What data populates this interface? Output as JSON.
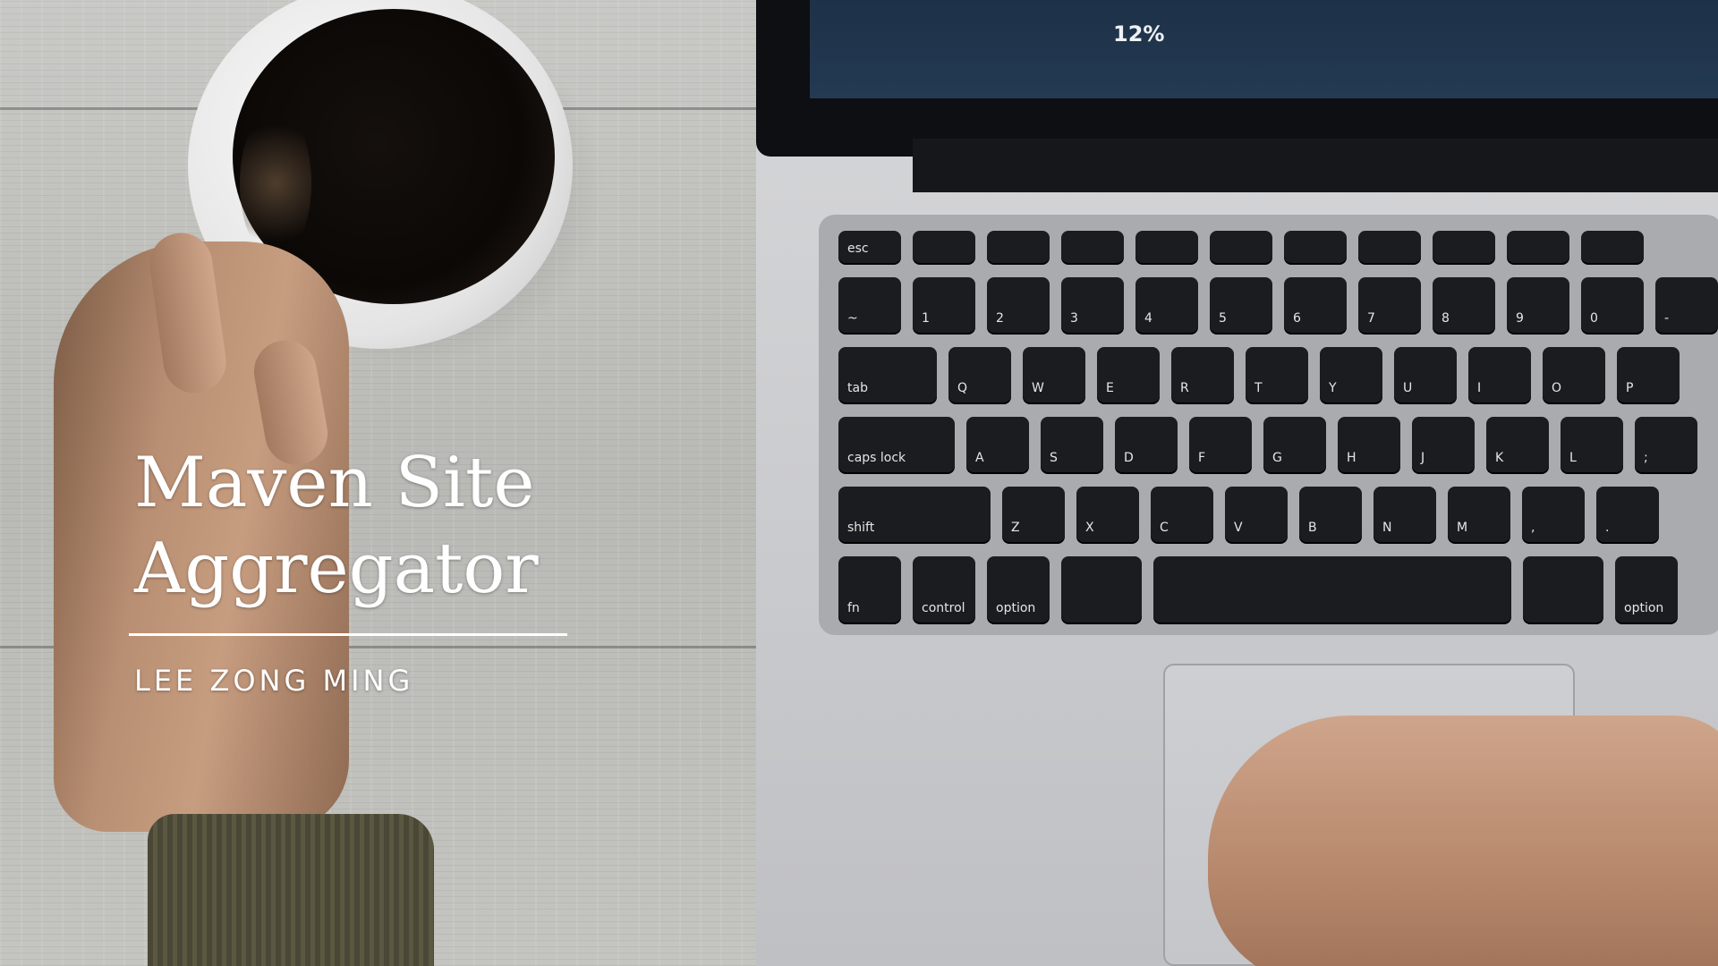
{
  "slide": {
    "title_line1": "Maven Site",
    "title_line2": "Aggregator",
    "author": "LEE ZONG MING"
  },
  "screen_chart": {
    "label": "12%"
  },
  "keyboard": {
    "row1": [
      "esc",
      "",
      "",
      "",
      "",
      "",
      "",
      "",
      "",
      "",
      ""
    ],
    "row2": [
      "~",
      "1",
      "2",
      "3",
      "4",
      "5",
      "6",
      "7",
      "8",
      "9",
      "0",
      "-"
    ],
    "row3": [
      "tab",
      "Q",
      "W",
      "E",
      "R",
      "T",
      "Y",
      "U",
      "I",
      "O",
      "P",
      "["
    ],
    "row4": [
      "caps lock",
      "A",
      "S",
      "D",
      "F",
      "G",
      "H",
      "J",
      "K",
      "L",
      ";"
    ],
    "row5": [
      "shift",
      "Z",
      "X",
      "C",
      "V",
      "B",
      "N",
      "M",
      ",",
      ".",
      "/"
    ],
    "row6": [
      "fn",
      "control",
      "option",
      "",
      "",
      "",
      "option"
    ]
  },
  "colors": {
    "screen": "#1d3148",
    "accent": "#49b2ad",
    "text": "#ffffff"
  }
}
